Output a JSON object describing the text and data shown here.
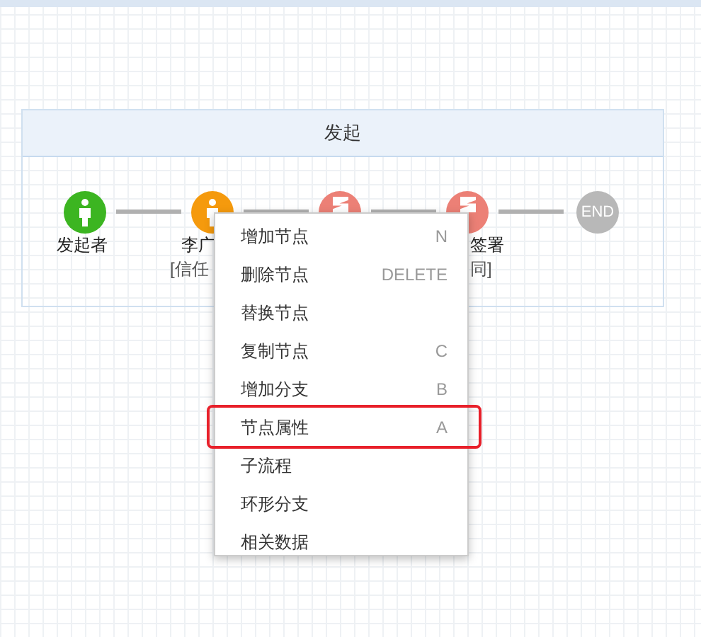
{
  "lane": {
    "title": "发起"
  },
  "nodes": [
    {
      "kind": "person",
      "color": "#3cb521",
      "label": "发起者"
    },
    {
      "kind": "person",
      "color": "#f59a0d",
      "label": "李广",
      "sublabel": "[信任"
    },
    {
      "kind": "sign",
      "color": "#ec8076"
    },
    {
      "kind": "sign",
      "color": "#ec8076",
      "label": "签署",
      "sublabel": "同]"
    },
    {
      "kind": "end",
      "color": "#b8b8b8",
      "label": "END"
    }
  ],
  "menu": [
    {
      "label": "增加节点",
      "shortcut": "N",
      "highlighted": false
    },
    {
      "label": "删除节点",
      "shortcut": "DELETE",
      "highlighted": false
    },
    {
      "label": "替换节点",
      "highlighted": false
    },
    {
      "label": "复制节点",
      "shortcut": "C",
      "highlighted": false
    },
    {
      "label": "增加分支",
      "shortcut": "B",
      "highlighted": false
    },
    {
      "label": "节点属性",
      "shortcut": "A",
      "highlighted": true
    },
    {
      "label": "子流程",
      "highlighted": false
    },
    {
      "label": "环形分支",
      "highlighted": false
    },
    {
      "label": "相关数据",
      "highlighted": false
    }
  ]
}
